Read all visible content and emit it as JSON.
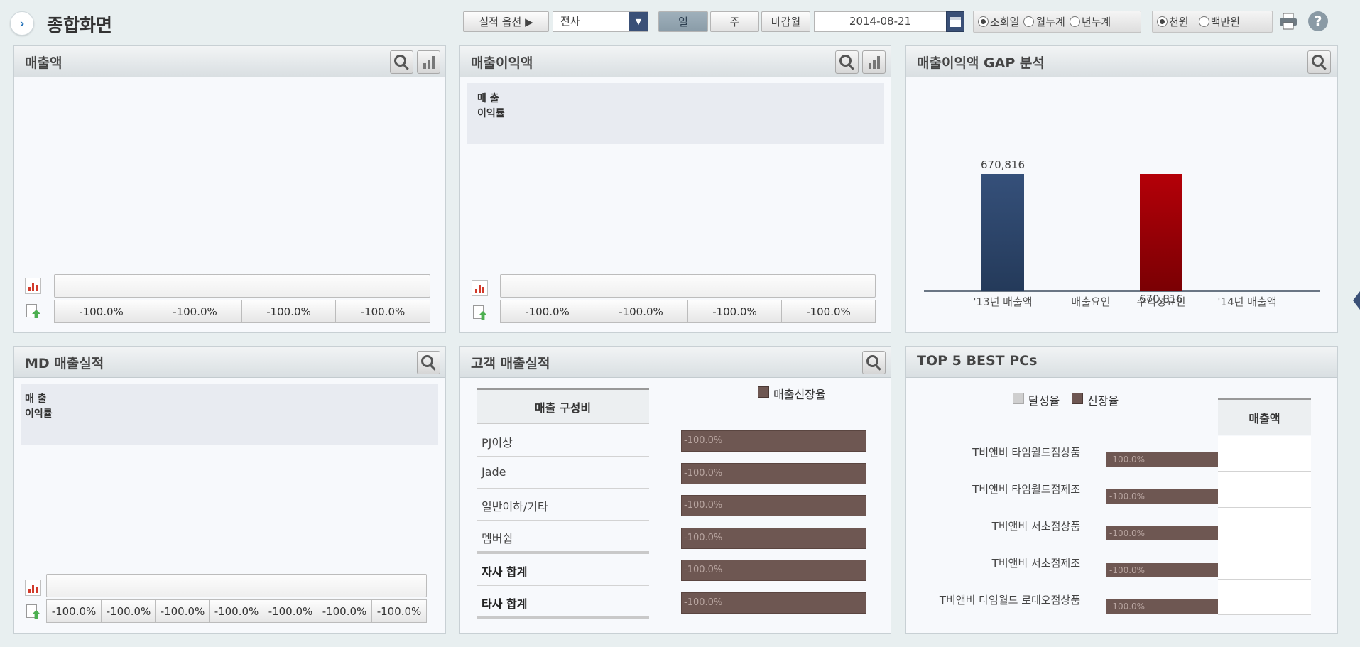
{
  "header": {
    "title": "종합화면",
    "option_label": "실적 옵션 ▶",
    "scope_select": "전사",
    "period_buttons": [
      "일",
      "주",
      "마감월"
    ],
    "date": "2014-08-21",
    "period_radios": [
      "조회일",
      "월누계",
      "년누계"
    ],
    "unit_radios": [
      "천원",
      "백만원"
    ]
  },
  "sales": {
    "title": "매출액",
    "pcts": [
      "-100.0%",
      "-100.0%",
      "-100.0%",
      "-100.0%"
    ]
  },
  "profit": {
    "title": "매출이익액",
    "legend_line1": "매 출",
    "legend_line2": "이익률",
    "pcts": [
      "-100.0%",
      "-100.0%",
      "-100.0%",
      "-100.0%"
    ]
  },
  "gap": {
    "title": "매출이익액 GAP 분석",
    "chart_data": {
      "type": "bar",
      "categories": [
        "'13년 매출액",
        "매출요인",
        "수익성요인",
        "'14년 매출액"
      ],
      "values": [
        670816,
        0,
        670816,
        0
      ],
      "value_labels": [
        "670,816",
        "",
        "670,816",
        ""
      ],
      "colors": [
        "#2e4466",
        "",
        "#a30005",
        ""
      ]
    }
  },
  "md": {
    "title": "MD 매출실적",
    "legend_line1": "매 출",
    "legend_line2": "이익률",
    "pcts": [
      "-100.0%",
      "-100.0%",
      "-100.0%",
      "-100.0%",
      "-100.0%",
      "-100.0%",
      "-100.0%"
    ]
  },
  "customer": {
    "title": "고객 매출실적",
    "legend": "매출신장율",
    "col_header": "매출 구성비",
    "rows": [
      {
        "label": "PJ이상",
        "pct": "-100.0%"
      },
      {
        "label": "Jade",
        "pct": "-100.0%"
      },
      {
        "label": "일반이하/기타",
        "pct": "-100.0%"
      },
      {
        "label": "멤버쉽",
        "pct": "-100.0%"
      },
      {
        "label": "자사 합계",
        "pct": "-100.0%"
      },
      {
        "label": "타사 합계",
        "pct": "-100.0%"
      }
    ]
  },
  "top5": {
    "title": "TOP 5 BEST PCs",
    "legend": [
      "달성율",
      "신장율"
    ],
    "col_header": "매출액",
    "items": [
      {
        "label": "T비앤비 타임월드점상품",
        "pct": "-100.0%"
      },
      {
        "label": "T비앤비 타임월드점제조",
        "pct": "-100.0%"
      },
      {
        "label": "T비앤비 서초점상품",
        "pct": "-100.0%"
      },
      {
        "label": "T비앤비 서초점제조",
        "pct": "-100.0%"
      },
      {
        "label": "T비앤비 타임월드 로데오점상품",
        "pct": "-100.0%"
      }
    ]
  }
}
